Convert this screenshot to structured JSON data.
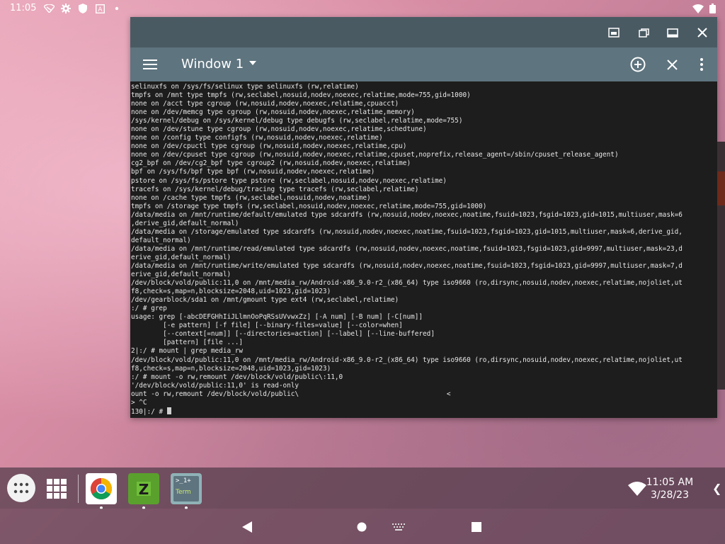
{
  "status_bar": {
    "time": "11:05",
    "icons": [
      "vpn-icon",
      "gear-icon",
      "shield-icon",
      "a-box-icon",
      "dot-icon",
      "wifi-icon",
      "battery-icon"
    ]
  },
  "window": {
    "title": "Window 1",
    "caption_buttons": [
      "screenshot-icon",
      "restore-icon",
      "maximize-icon",
      "close-icon"
    ],
    "toolbar_icons": [
      "menu-icon",
      "add-window-icon",
      "close-window-icon",
      "more-icon"
    ]
  },
  "terminal": {
    "lines": [
      "selinuxfs on /sys/fs/selinux type selinuxfs (rw,relatime)",
      "tmpfs on /mnt type tmpfs (rw,seclabel,nosuid,nodev,noexec,relatime,mode=755,gid=1000)",
      "none on /acct type cgroup (rw,nosuid,nodev,noexec,relatime,cpuacct)",
      "none on /dev/memcg type cgroup (rw,nosuid,nodev,noexec,relatime,memory)",
      "/sys/kernel/debug on /sys/kernel/debug type debugfs (rw,seclabel,relatime,mode=755)",
      "none on /dev/stune type cgroup (rw,nosuid,nodev,noexec,relatime,schedtune)",
      "none on /config type configfs (rw,nosuid,nodev,noexec,relatime)",
      "none on /dev/cpuctl type cgroup (rw,nosuid,nodev,noexec,relatime,cpu)",
      "none on /dev/cpuset type cgroup (rw,nosuid,nodev,noexec,relatime,cpuset,noprefix,release_agent=/sbin/cpuset_release_agent)",
      "cg2_bpf on /dev/cg2_bpf type cgroup2 (rw,nosuid,nodev,noexec,relatime)",
      "bpf on /sys/fs/bpf type bpf (rw,nosuid,nodev,noexec,relatime)",
      "pstore on /sys/fs/pstore type pstore (rw,seclabel,nosuid,nodev,noexec,relatime)",
      "tracefs on /sys/kernel/debug/tracing type tracefs (rw,seclabel,relatime)",
      "none on /cache type tmpfs (rw,seclabel,nosuid,nodev,noatime)",
      "tmpfs on /storage type tmpfs (rw,seclabel,nosuid,nodev,noexec,relatime,mode=755,gid=1000)",
      "/data/media on /mnt/runtime/default/emulated type sdcardfs (rw,nosuid,nodev,noexec,noatime,fsuid=1023,fsgid=1023,gid=1015,multiuser,mask=6",
      ",derive_gid,default_normal)",
      "/data/media on /storage/emulated type sdcardfs (rw,nosuid,nodev,noexec,noatime,fsuid=1023,fsgid=1023,gid=1015,multiuser,mask=6,derive_gid,",
      "default_normal)",
      "/data/media on /mnt/runtime/read/emulated type sdcardfs (rw,nosuid,nodev,noexec,noatime,fsuid=1023,fsgid=1023,gid=9997,multiuser,mask=23,d",
      "erive_gid,default_normal)",
      "/data/media on /mnt/runtime/write/emulated type sdcardfs (rw,nosuid,nodev,noexec,noatime,fsuid=1023,fsgid=1023,gid=9997,multiuser,mask=7,d",
      "erive_gid,default_normal)",
      "/dev/block/vold/public:11,0 on /mnt/media_rw/Android-x86_9.0-r2_(x86_64) type iso9660 (ro,dirsync,nosuid,nodev,noexec,relatime,nojoliet,ut",
      "f8,check=s,map=n,blocksize=2048,uid=1023,gid=1023)",
      "/dev/gearblock/sda1 on /mnt/gmount type ext4 (rw,seclabel,relatime)",
      ":/ # grep",
      "usage: grep [-abcDEFGHhIiJLlmnOoPqRSsUVvwxZz] [-A num] [-B num] [-C[num]]",
      "        [-e pattern] [-f file] [--binary-files=value] [--color=when]",
      "        [--context[=num]] [--directories=action] [--label] [--line-buffered]",
      "        [pattern] [file ...]",
      "2|:/ # mount | grep media_rw",
      "/dev/block/vold/public:11,0 on /mnt/media_rw/Android-x86_9.0-r2_(x86_64) type iso9660 (ro,dirsync,nosuid,nodev,noexec,relatime,nojoliet,ut",
      "f8,check=s,map=n,blocksize=2048,uid=1023,gid=1023)",
      ":/ # mount -o rw,remount /dev/block/vold/public\\:11,0",
      "'/dev/block/vold/public:11,0' is read-only",
      "ount -o rw,remount /dev/block/vold/public\\                                     <",
      "> ^C"
    ],
    "prompt": "130|:/ # "
  },
  "taskbar": {
    "apps": [
      {
        "name": "Chrome"
      },
      {
        "name": "ZArchiver"
      },
      {
        "name": "Term",
        "label_top": ">_1+",
        "label_bottom": "Term"
      }
    ],
    "clock_time": "11:05 AM",
    "clock_date": "3/28/23",
    "chevron": "❮"
  }
}
